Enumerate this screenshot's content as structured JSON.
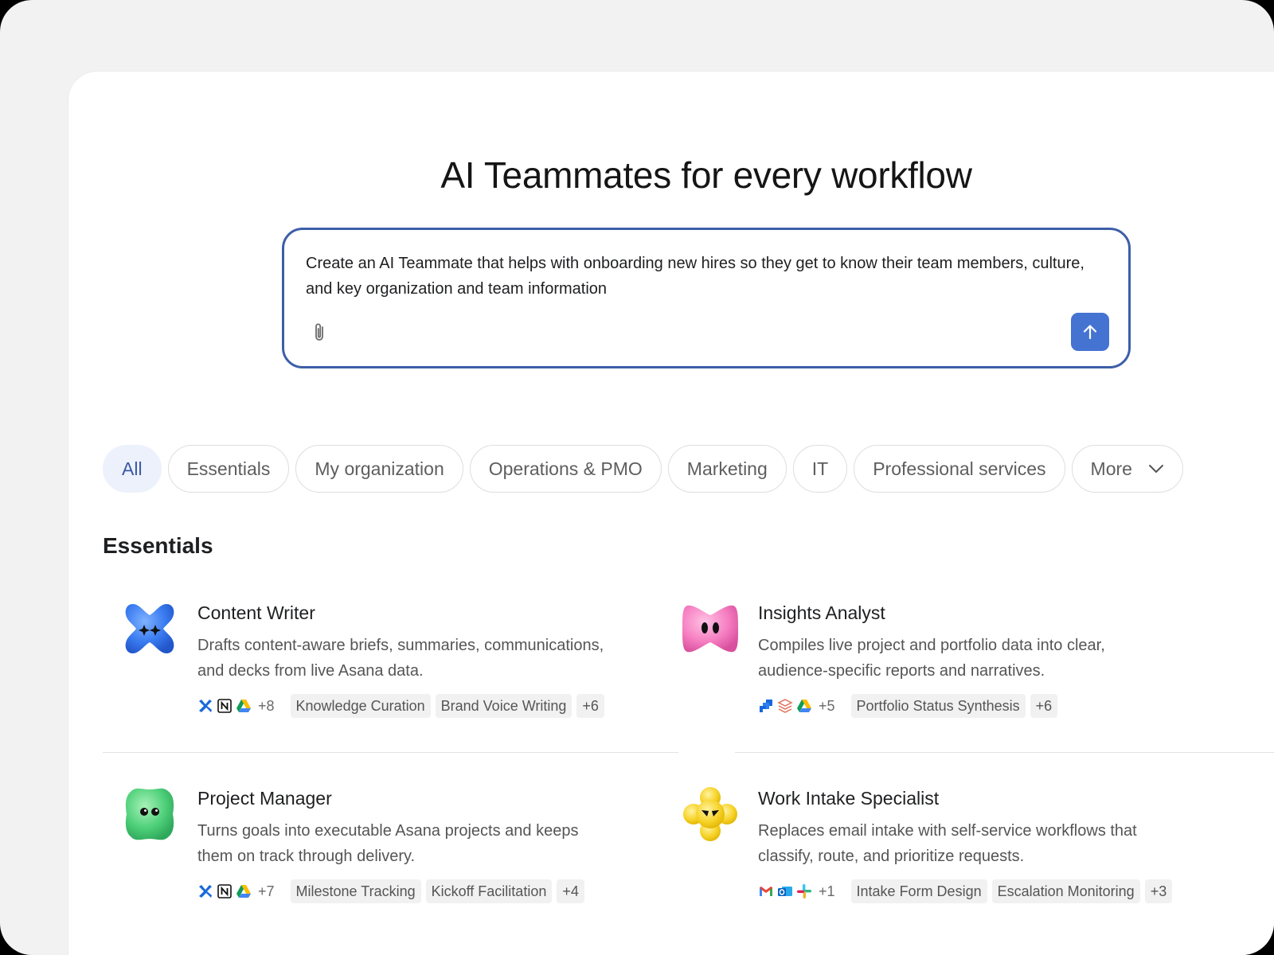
{
  "hero": {
    "title": "AI Teammates for every workflow"
  },
  "prompt": {
    "value": "Create an AI Teammate that helps with onboarding new hires so they get to know their team members, culture, and key organization and team information",
    "attach_icon": "paperclip-icon",
    "send_icon": "arrow-up-icon"
  },
  "filters": {
    "items": [
      {
        "label": "All",
        "active": true
      },
      {
        "label": "Essentials",
        "active": false
      },
      {
        "label": "My organization",
        "active": false
      },
      {
        "label": "Operations & PMO",
        "active": false
      },
      {
        "label": "Marketing",
        "active": false
      },
      {
        "label": "IT",
        "active": false
      },
      {
        "label": "Professional services",
        "active": false
      },
      {
        "label": "More",
        "active": false
      }
    ]
  },
  "section": {
    "title": "Essentials"
  },
  "cards": [
    {
      "name": "Content Writer",
      "description": "Drafts content-aware briefs, summaries, communications, and decks from live Asana data.",
      "avatar": "blue-x-creature",
      "app_icons": [
        "confluence-icon",
        "notion-icon",
        "google-drive-icon"
      ],
      "app_count": "+8",
      "tags": [
        "Knowledge Curation",
        "Brand Voice Writing",
        "+6"
      ]
    },
    {
      "name": "Insights Analyst",
      "description": "Compiles live project and portfolio data into clear, audience-specific reports and narratives.",
      "avatar": "pink-bow-creature",
      "app_icons": [
        "jira-icon",
        "stack-icon",
        "google-drive-icon"
      ],
      "app_count": "+5",
      "tags": [
        "Portfolio Status Synthesis",
        "+6"
      ]
    },
    {
      "name": "Project Manager",
      "description": "Turns goals into executable Asana projects and keeps them on track through delivery.",
      "avatar": "green-blob-creature",
      "app_icons": [
        "confluence-icon",
        "notion-icon",
        "google-drive-icon"
      ],
      "app_count": "+7",
      "tags": [
        "Milestone Tracking",
        "Kickoff Facilitation",
        "+4"
      ]
    },
    {
      "name": "Work Intake Specialist",
      "description": "Replaces email intake with self-service workflows that classify, route, and prioritize requests.",
      "avatar": "yellow-flower-creature",
      "app_icons": [
        "gmail-icon",
        "outlook-icon",
        "slack-icon"
      ],
      "app_count": "+1",
      "tags": [
        "Intake Form Design",
        "Escalation Monitoring",
        "+3"
      ]
    }
  ],
  "colors": {
    "accent": "#4573d2",
    "prompt_border": "#3d5ea8",
    "chip_active_bg": "#edf1fb",
    "chip_active_text": "#3a5aa5"
  }
}
